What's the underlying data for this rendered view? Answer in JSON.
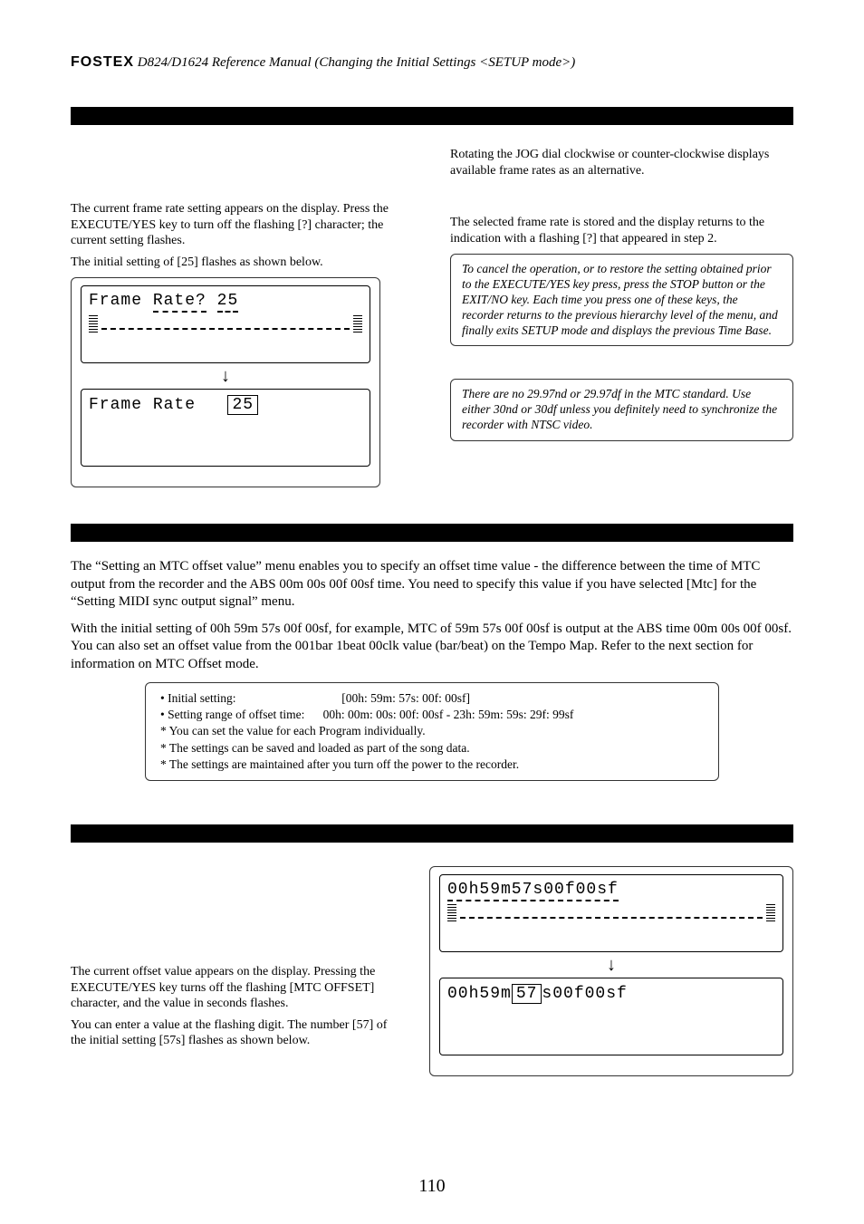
{
  "header": {
    "logo": "FOSTEX",
    "title": "D824/D1624 Reference Manual (Changing the Initial Settings <SETUP mode>)"
  },
  "top_section": {
    "left": {
      "para1": "The current frame rate setting appears on the display. Press the EXECUTE/YES key to turn off the flashing [?] character; the current setting flashes.",
      "para2": "The initial setting of [25] flashes as shown below.",
      "lcd1_line1_a": "Frame",
      "lcd1_line1_b": "Rate?",
      "lcd1_line1_c": "25",
      "lcd2_line1_a": "Frame",
      "lcd2_line1_b": "Rate",
      "lcd2_line1_c": "25"
    },
    "right": {
      "para1": "Rotating the JOG dial clockwise or counter-clockwise displays available frame rates as an alternative.",
      "para2": "The selected frame rate is stored and the display returns to the indication with a flashing [?] that appeared in step 2.",
      "note1": "To cancel the operation, or to restore the setting obtained prior to the EXECUTE/YES key press, press the STOP button or the EXIT/NO key.  Each time you press one of these keys, the recorder returns to the previous hierarchy level of the menu, and finally exits SETUP mode and displays the previous Time Base.",
      "note2": "There are no 29.97nd or 29.97df in the MTC standard. Use either 30nd or 30df unless you definitely need to synchronize the recorder with NTSC video."
    }
  },
  "mid_section": {
    "intro": "The “Setting an MTC offset value” menu enables you to specify an offset time value - the difference between the time of MTC output from the recorder and the ABS 00m 00s 00f 00sf time.  You need to specify this value if you have selected [Mtc] for the “Setting MIDI sync output signal” menu.",
    "intro2": "With the initial setting of 00h 59m 57s 00f 00sf, for example, MTC of 59m 57s 00f 00sf is output at the ABS time 00m 00s 00f 00sf.  You can also set an offset value from the 001bar 1beat  00clk value (bar/beat) on the Tempo Map.  Refer to the next section for information on MTC Offset mode.",
    "settings": {
      "b1_label": "Initial setting:",
      "b1_value": "[00h: 59m: 57s: 00f: 00sf]",
      "b2_label": "Setting range of offset time:",
      "b2_value": "00h: 00m: 00s: 00f: 00sf - 23h: 59m: 59s: 29f: 99sf",
      "s1": "* You can set the value for each Program individually.",
      "s2": "* The settings can be saved and loaded as part of the song data.",
      "s3": "* The settings are maintained after you turn off the power to the recorder."
    }
  },
  "bottom_section": {
    "left": {
      "para1": "The current offset value appears on the display. Pressing the EXECUTE/YES key turns off the flashing [MTC OFFSET] character, and the value in seconds flashes.",
      "para2": "You can enter a value at the flashing digit.  The number [57] of the initial setting [57s] flashes as shown below."
    },
    "right": {
      "lcd1": "00h59m57s00f00sf",
      "lcd2_a": "00h59m",
      "lcd2_b": "57",
      "lcd2_c": "s00f00sf"
    }
  },
  "page_number": "110"
}
